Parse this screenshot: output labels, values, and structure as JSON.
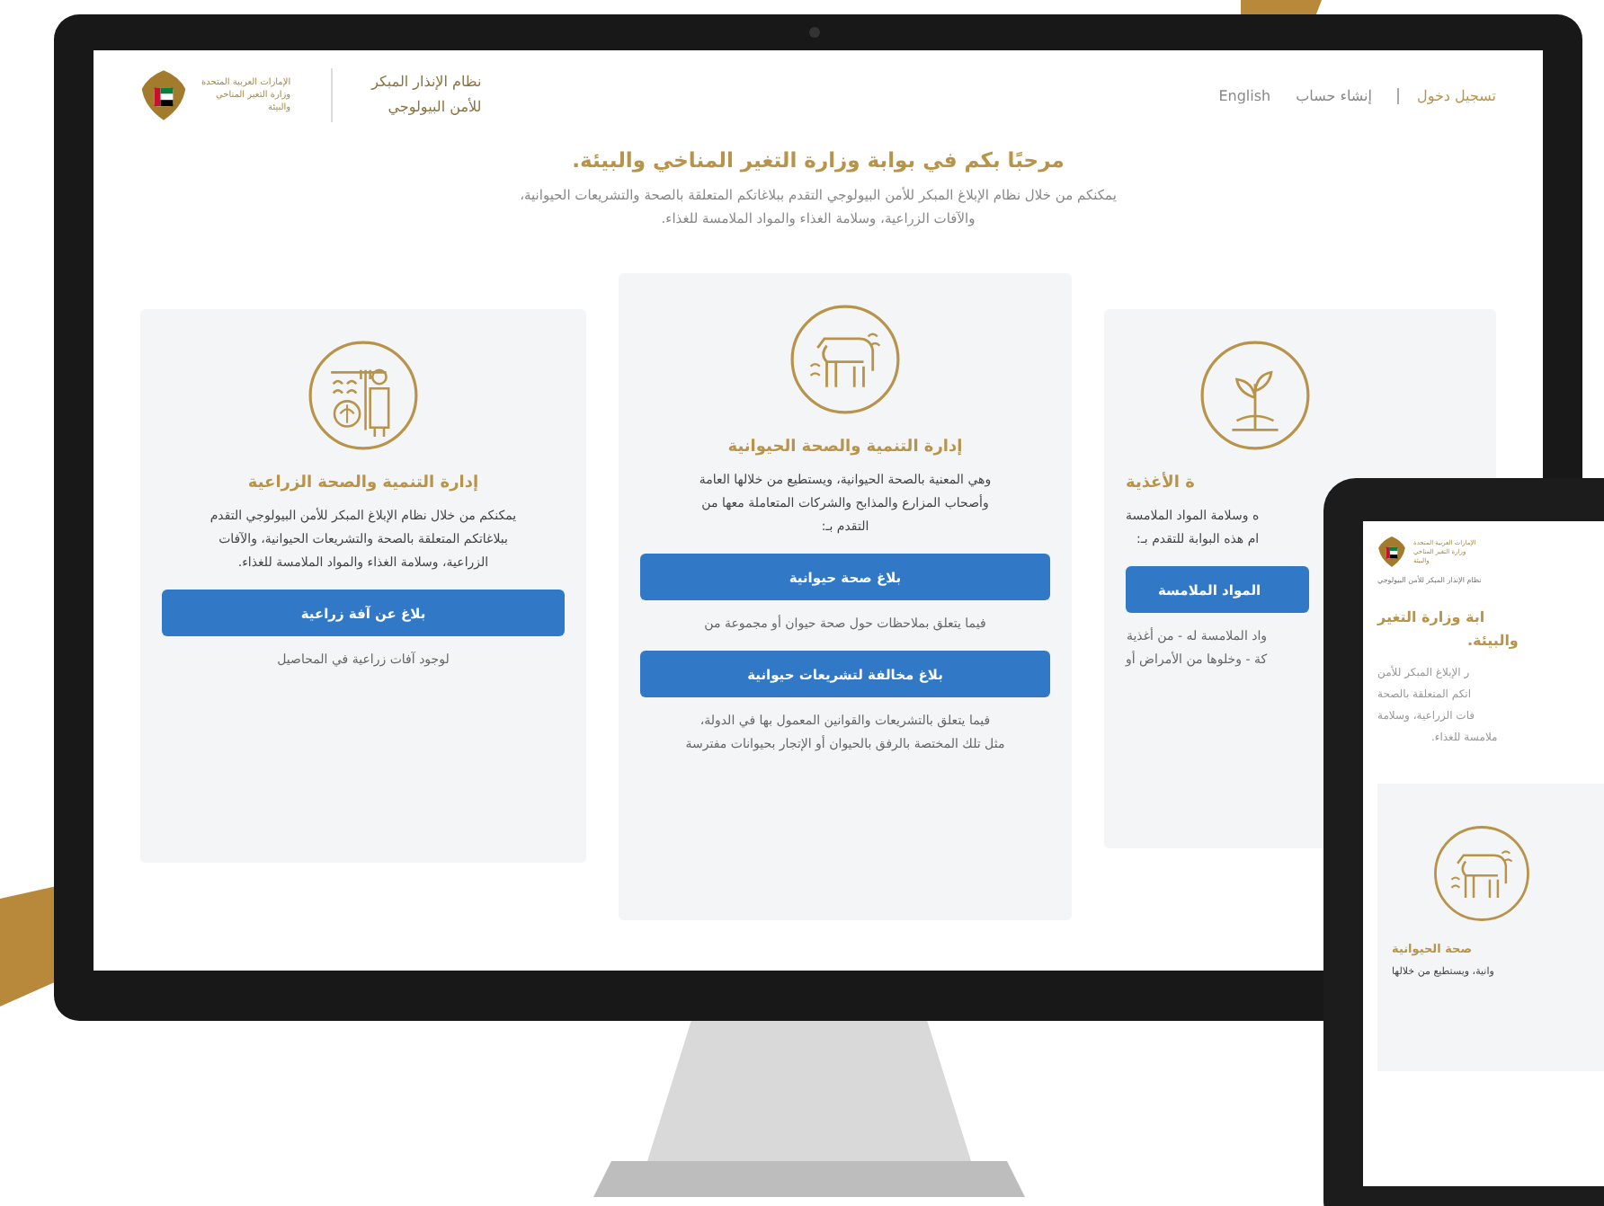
{
  "monitor": {
    "header": {
      "logo_text": [
        "الإمارات العربية المتحدة",
        "وزارة التغير المناخي",
        "والبيئة"
      ],
      "system_name": [
        "نظام الإنذار المبكر",
        "للأمن البيولوجي"
      ],
      "nav": [
        {
          "label": "تسجيل دخول",
          "kind": "primary"
        },
        {
          "label": "إنشاء حساب",
          "kind": "link"
        },
        {
          "label": "English",
          "kind": "link"
        }
      ]
    },
    "title": "مرحبًا بكم في بوابة وزارة التغير المناخي والبيئة.",
    "intro": [
      "يمكنكم من خلال نظام الإبلاغ المبكر للأمن البيولوجي التقدم ببلاغاتكم المتعلقة بالصحة والتشريعات الحيوانية،",
      "والآفات الزراعية، وسلامة الغذاء والمواد الملامسة للغذاء."
    ],
    "cards": [
      {
        "kind": "farmer",
        "title": "إدارة التنمية والصحة الزراعية",
        "description": [
          "يمكنكم من خلال نظام الإبلاغ المبكر للأمن البيولوجي التقدم",
          "ببلاغاتكم المتعلقة بالصحة والتشريعات الحيوانية، والآفات",
          "الزراعية، وسلامة الغذاء والمواد الملامسة للغذاء."
        ],
        "actions": [
          {
            "button": "بلاغ عن آفة زراعية",
            "note": [
              "لوجود آفات زراعية في المحاصيل"
            ]
          }
        ]
      },
      {
        "kind": "cow",
        "title": "إدارة التنمية والصحة الحيوانية",
        "description": [
          "وهي المعنية بالصحة الحيوانية، ويستطيع من خلالها العامة",
          "وأصحاب المزارع والمذابح والشركات المتعاملة معها من",
          "التقدم بـ:"
        ],
        "actions": [
          {
            "button": "بلاغ صحة حيوانية",
            "note": [
              "فيما يتعلق بملاحظات حول صحة حيوان أو مجموعة من"
            ]
          },
          {
            "button": "بلاغ مخالفة لتشريعات حيوانية",
            "note": [
              "فيما يتعلق بالتشريعات والقوانين المعمول بها في الدولة،",
              "مثل تلك المختصة بالرفق بالحيوان أو الإتجار بحيوانات مفترسة"
            ]
          }
        ]
      },
      {
        "kind": "plant",
        "title": "ة الأغذية",
        "description": [
          "ه وسلامة المواد الملامسة",
          "ام هذه البوابة للتقدم بـ:"
        ],
        "actions": [
          {
            "button": "المواد الملامسة",
            "note": [
              "واد الملامسة له - من أغذية",
              "كة - وخلوها من الأمراض أو"
            ]
          }
        ]
      }
    ]
  },
  "tablet": {
    "logo_text": [
      "الإمارات العربية المتحدة",
      "وزارة التغير المناخي",
      "والبيئة"
    ],
    "system_name": "نظام الإنذار المبكر للأمن البيولوجي",
    "title": [
      "ابة وزارة التغير",
      "والبيئة."
    ],
    "intro": [
      "ر الإبلاغ المبكر للأمن",
      "اتكم المتعلقة بالصحة",
      "فات الزراعية، وسلامة",
      "ملامسة للغذاء."
    ],
    "card": {
      "kind": "cow",
      "title": "صحة الحيوانية",
      "description": [
        "وانية، ويستطيع من خلالها"
      ]
    }
  }
}
